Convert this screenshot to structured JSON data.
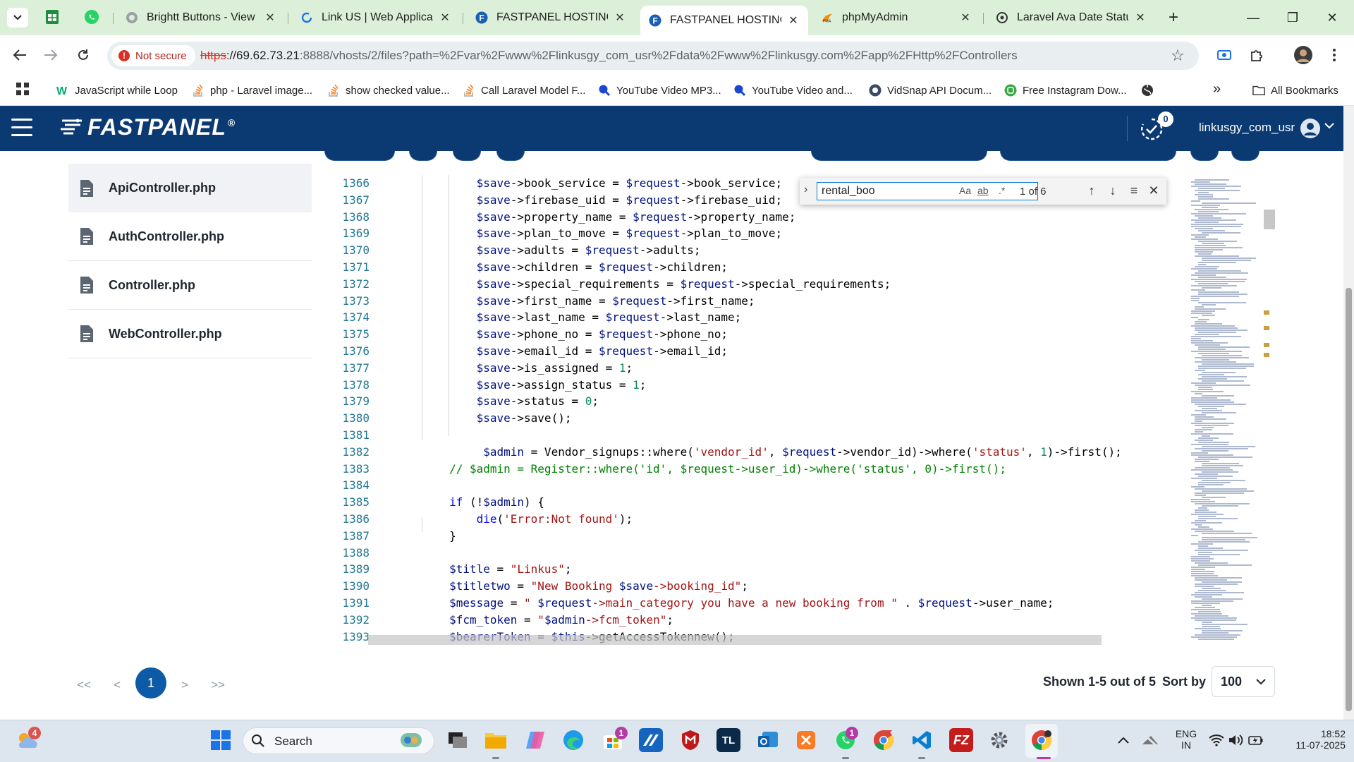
{
  "browser": {
    "tabs": [
      {
        "title": "Brightt Buttons - View S",
        "icon": "globe-gray-icon"
      },
      {
        "title": "Link US | Web Applicatio",
        "icon": "loading-icon"
      },
      {
        "title": "FASTPANEL HOSTING CO",
        "icon": "fastpanel-icon"
      },
      {
        "title": "FASTPANEL HOSTING CO",
        "icon": "fastpanel-icon",
        "active": true
      },
      {
        "title": "phpMyAdmin",
        "icon": "phpmyadmin-icon"
      },
      {
        "title": "Laravel Ava Date Status",
        "icon": "openai-icon"
      }
    ],
    "security_label": "Not secure",
    "url": {
      "scheme": "https",
      "host": "://69.62.73.21",
      "path": ":8888/vhosts/2/files?path=%2Fvar%2Fwww%2Flinkusgy_com_usr%2Fdata%2Fwww%2Flinkusgy.com%2Fapp%2FHttp%2FControllers"
    },
    "bookmarks": [
      {
        "label": "JavaScript while Loop"
      },
      {
        "label": "php - Laravel image..."
      },
      {
        "label": "show checked value..."
      },
      {
        "label": "Call Laravel Model F..."
      },
      {
        "label": "YouTube Video MP3..."
      },
      {
        "label": "YouTube Video and..."
      },
      {
        "label": "VidSnap API Docum..."
      },
      {
        "label": "Free Instagram Dow..."
      }
    ],
    "all_bookmarks": "All Bookmarks"
  },
  "panel": {
    "logo": "FASTPANEL",
    "logo_mark": "®",
    "notification_count": "0",
    "user": "linkusgy_com_usr"
  },
  "files": [
    {
      "name": "ApiController.php"
    },
    {
      "name": "AuthController.php"
    },
    {
      "name": "Controller.php"
    },
    {
      "name": "WebController.php"
    }
  ],
  "editor": {
    "line_numbers": [
      "1366",
      "1367",
      "1368",
      "1369",
      "1370",
      "1371",
      "1372",
      "1373",
      "1374",
      "1375",
      "1376",
      "1377",
      "1378",
      "1379",
      "1380",
      "1381",
      "1382",
      "1383",
      "1384",
      "1385",
      "1386",
      "1387",
      "1388",
      "1389",
      "1390",
      "1391",
      "1392",
      "1393"
    ],
    "lines": [
      "            $save->book_service = $request->book_service;",
      "            $save->firebase_uid = $request->firebase_uid;",
      "            $save->property_name = $request->property_name;",
      "            $save->plan_to_move = $request->plan_to_move;",
      "            $save->adults = $request->adults;",
      "            $save->children = $request->children;",
      "            $save->special_requirements = $request->special_requirements;",
      "            $save->first_name = $request->first_name;",
      "            $save->last_name = $request->last_name;",
      "            $save->phone_no = $request->phone_no;",
      "            $save->email_id = $request->email_id;",
      "            $save->is_assigned = 1;",
      "            $save->assign_status = 1;",
      "            $save->status = 0;",
      "            $save->save();",
      "",
      "             $admin = Vendor_signups::where('vendor_id', $request->vendor_id)->where('status', 1)->first();",
      "        // $admin = Register::where('id', $request->user_id)->where('status', 0)->first();",
      "",
      "        if (!$admin) {",
      "            die('Error:Not found');",
      "        }",
      "",
      "        $title = \"Linkus\";",
      "        $titletwo = \"New Booking $save->booking_id\";",
      "        $message = \" $request->main_category you have a new booking from \" . $request->user_name;",
      "        $fcm_token = \"$admin->fcm_token\";",
      "        $bearerToken = $this->getAccessTokennew();"
    ],
    "find": {
      "query": "rental_boo",
      "match_case": "Aa",
      "whole_word": "ab",
      "regex": ".*",
      "count": "1 of 6"
    }
  },
  "pagination": {
    "first": "<<",
    "prev": "<",
    "current": "1",
    "next": ">",
    "last": ">>",
    "shown": "Shown 1-5 out of 5",
    "sort_by_label": "Sort by",
    "sort_by_value": "100"
  },
  "taskbar": {
    "weather_badge": "4",
    "search_label": "Search",
    "store_badge": "1",
    "whatsapp_badge": "1",
    "lang_top": "ENG",
    "lang_bottom": "IN",
    "time": "18:52",
    "date": "11-07-2025"
  },
  "colors": {
    "panel_header": "#0b3a72",
    "tabstrip": "#dcefd8",
    "pagination_active": "#0d5aa7"
  }
}
